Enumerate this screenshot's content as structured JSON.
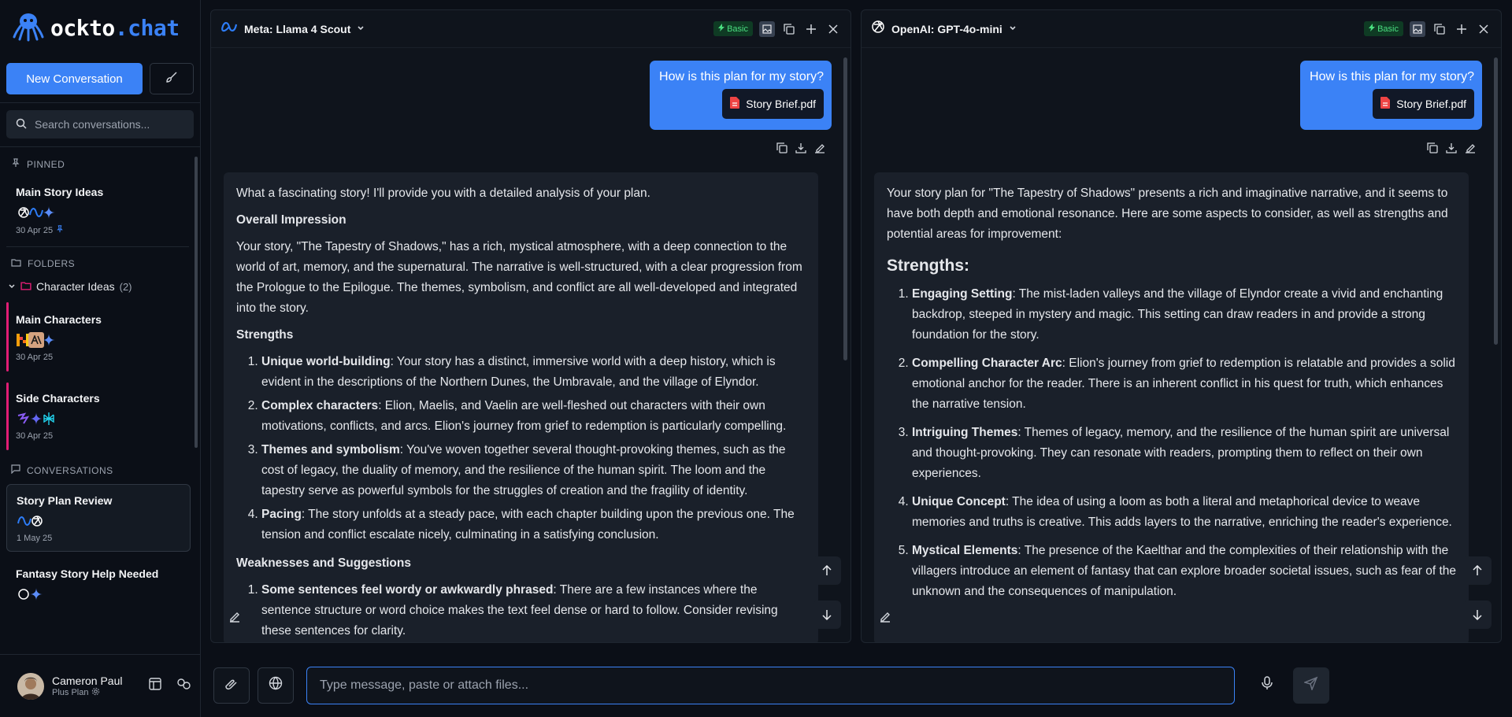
{
  "app": {
    "logo_prefix": "ockto",
    "logo_dot": ".",
    "logo_suffix": "chat"
  },
  "sidebar": {
    "new_conversation": "New Conversation",
    "search_placeholder": "Search conversations...",
    "pinned_label": "PINNED",
    "pinned_items": [
      {
        "title": "Main Story Ideas",
        "date": "30 Apr 25"
      }
    ],
    "folders_label": "FOLDERS",
    "folder": {
      "name": "Character Ideas",
      "count": "(2)"
    },
    "folder_items": [
      {
        "title": "Main Characters",
        "date": "30 Apr 25"
      },
      {
        "title": "Side Characters",
        "date": "30 Apr 25"
      }
    ],
    "conversations_label": "CONVERSATIONS",
    "conversations": [
      {
        "title": "Story Plan Review",
        "date": "1 May 25"
      },
      {
        "title": "Fantasy Story Help Needed"
      }
    ]
  },
  "profile": {
    "name": "Cameron Paul",
    "plan": "Plus Plan"
  },
  "panels": [
    {
      "model": "Meta: Llama 4 Scout",
      "badge": "Basic",
      "user_message": "How is this plan for my story?",
      "attachment": "Story Brief.pdf",
      "reply": {
        "intro": "What a fascinating story! I'll provide you with a detailed analysis of your plan.",
        "h1": "Overall Impression",
        "p1": "Your story, \"The Tapestry of Shadows,\" has a rich, mystical atmosphere, with a deep connection to the world of art, memory, and the supernatural. The narrative is well-structured, with a clear progression from the Prologue to the Epilogue. The themes, symbolism, and conflict are all well-developed and integrated into the story.",
        "h2": "Strengths",
        "items": [
          {
            "b": "Unique world-building",
            "t": ": Your story has a distinct, immersive world with a deep history, which is evident in the descriptions of the Northern Dunes, the Umbravale, and the village of Elyndor."
          },
          {
            "b": "Complex characters",
            "t": ": Elion, Maelis, and Vaelin are well-fleshed out characters with their own motivations, conflicts, and arcs. Elion's journey from grief to redemption is particularly compelling."
          },
          {
            "b": "Themes and symbolism",
            "t": ": You've woven together several thought-provoking themes, such as the cost of legacy, the duality of memory, and the resilience of the human spirit. The loom and the tapestry serve as powerful symbols for the struggles of creation and the fragility of identity."
          },
          {
            "b": "Pacing",
            "t": ": The story unfolds at a steady pace, with each chapter building upon the previous one. The tension and conflict escalate nicely, culminating in a satisfying conclusion."
          }
        ],
        "h3": "Weaknesses and Suggestions",
        "items2": [
          {
            "b": "Some sentences feel wordy or awkwardly phrased",
            "t": ": There are a few instances where the sentence structure or word choice makes the text feel dense or hard to follow. Consider revising these sentences for clarity."
          }
        ]
      }
    },
    {
      "model": "OpenAI: GPT-4o-mini",
      "badge": "Basic",
      "user_message": "How is this plan for my story?",
      "attachment": "Story Brief.pdf",
      "reply": {
        "intro": "Your story plan for \"The Tapestry of Shadows\" presents a rich and imaginative narrative, and it seems to have both depth and emotional resonance. Here are some aspects to consider, as well as strengths and potential areas for improvement:",
        "h2": "Strengths:",
        "items": [
          {
            "b": "Engaging Setting",
            "t": ": The mist-laden valleys and the village of Elyndor create a vivid and enchanting backdrop, steeped in mystery and magic. This setting can draw readers in and provide a strong foundation for the story."
          },
          {
            "b": "Compelling Character Arc",
            "t": ": Elion's journey from grief to redemption is relatable and provides a solid emotional anchor for the reader. There is an inherent conflict in his quest for truth, which enhances the narrative tension."
          },
          {
            "b": "Intriguing Themes",
            "t": ": Themes of legacy, memory, and the resilience of the human spirit are universal and thought-provoking. They can resonate with readers, prompting them to reflect on their own experiences."
          },
          {
            "b": "Unique Concept",
            "t": ": The idea of using a loom as both a literal and metaphorical device to weave memories and truths is creative. This adds layers to the narrative, enriching the reader's experience."
          },
          {
            "b": "Mystical Elements",
            "t": ": The presence of the Kaelthar and the complexities of their relationship with the villagers introduce an element of fantasy that can explore broader societal issues, such as fear of the unknown and the consequences of manipulation."
          }
        ]
      }
    }
  ],
  "composer": {
    "placeholder": "Type message, paste or attach files..."
  },
  "colors": {
    "accent": "#3b82f6",
    "folder_pink": "#e11d74",
    "badge_green": "#4ade80",
    "pdf_red": "#ef4444"
  }
}
